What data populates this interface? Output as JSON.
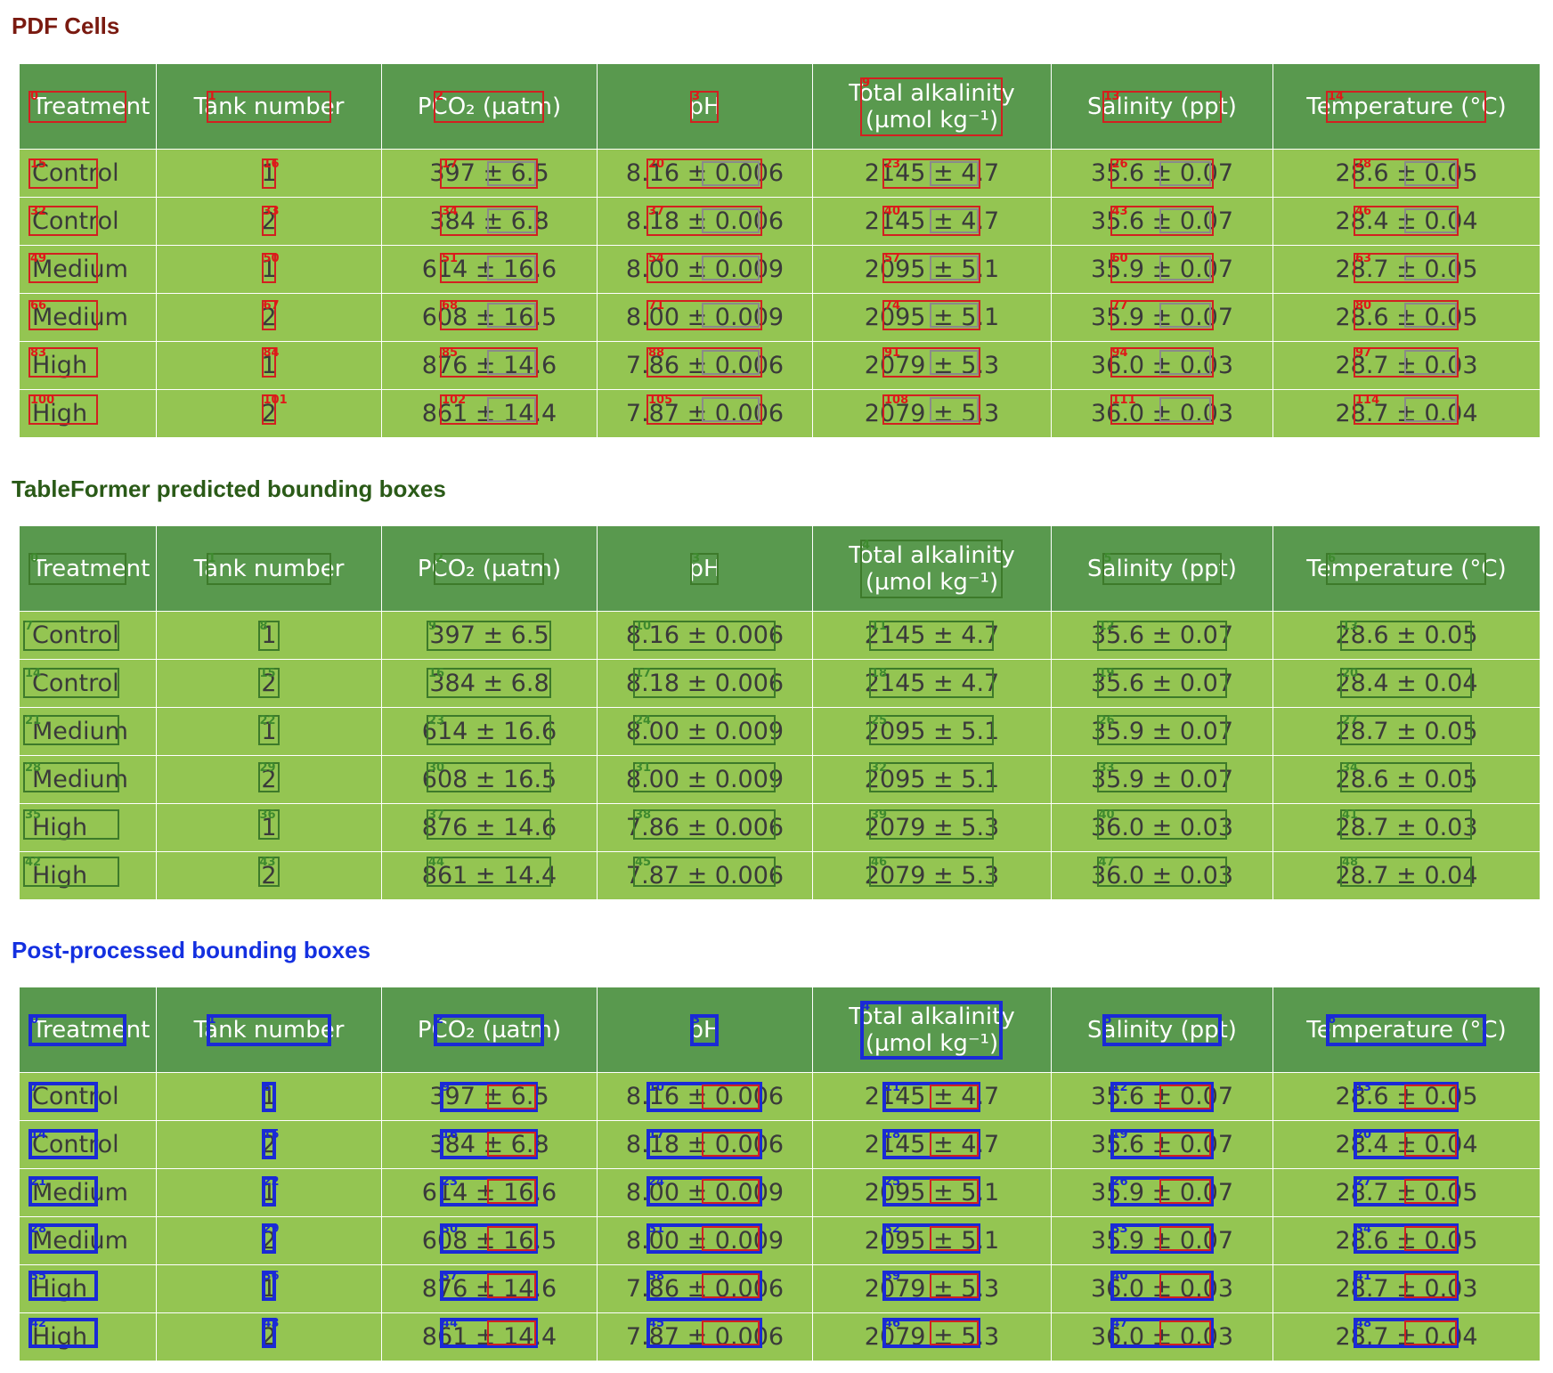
{
  "sections": [
    {
      "title": "PDF Cells",
      "color": "#7a1a10"
    },
    {
      "title": "TableFormer predicted bounding boxes",
      "color": "#2a5a17"
    },
    {
      "title": "Post-processed bounding boxes",
      "color": "#1430e0"
    }
  ],
  "table": {
    "header_bg": "#59994e",
    "body_bg": "#94c552",
    "headers": [
      {
        "line1": "Treatment",
        "line2": ""
      },
      {
        "line1": "Tank number",
        "line2": ""
      },
      {
        "line1": "PCO₂ (µatm)",
        "line2": ""
      },
      {
        "line1": "pH",
        "line2": ""
      },
      {
        "line1": "Total alkalinity",
        "line2": "(µmol kg⁻¹)"
      },
      {
        "line1": "Salinity (ppt)",
        "line2": ""
      },
      {
        "line1": "Temperature (°C)",
        "line2": ""
      }
    ],
    "rows": [
      [
        "Control",
        "1",
        "397 ± 6.5",
        "8.16 ± 0.006",
        "2145 ± 4.7",
        "35.6 ± 0.07",
        "28.6 ± 0.05"
      ],
      [
        "Control",
        "2",
        "384 ± 6.8",
        "8.18 ± 0.006",
        "2145 ± 4.7",
        "35.6 ± 0.07",
        "28.4 ± 0.04"
      ],
      [
        "Medium",
        "1",
        "614 ± 16.6",
        "8.00 ± 0.009",
        "2095 ± 5.1",
        "35.9 ± 0.07",
        "28.7 ± 0.05"
      ],
      [
        "Medium",
        "2",
        "608 ± 16.5",
        "8.00 ± 0.009",
        "2095 ± 5.1",
        "35.9 ± 0.07",
        "28.6 ± 0.05"
      ],
      [
        "High",
        "1",
        "876 ± 14.6",
        "7.86 ± 0.006",
        "2079 ± 5.3",
        "36.0 ± 0.03",
        "28.7 ± 0.03"
      ],
      [
        "High",
        "2",
        "861 ± 14.4",
        "7.87 ± 0.006",
        "2079 ± 5.3",
        "36.0 ± 0.03",
        "28.7 ± 0.04"
      ]
    ]
  },
  "overlay_colors": {
    "pdf_cell": "#d22020",
    "pdf_cell_secondary": "#8a8a8a",
    "predicted": "#3d7a2a",
    "postprocessed": "#1a2ad6"
  },
  "tableformer_indices": {
    "headers": [
      "0",
      "1",
      "2",
      "3",
      "4",
      "5",
      "6"
    ],
    "rows": [
      [
        "7",
        "8",
        "9",
        "10",
        "11",
        "12",
        "13"
      ],
      [
        "14",
        "15",
        "16",
        "17",
        "18",
        "19",
        "20"
      ],
      [
        "21",
        "22",
        "23",
        "24",
        "25",
        "26",
        "27"
      ],
      [
        "28",
        "29",
        "30",
        "31",
        "32",
        "33",
        "34"
      ],
      [
        "35",
        "36",
        "37",
        "38",
        "39",
        "40",
        "41"
      ],
      [
        "42",
        "43",
        "44",
        "45",
        "46",
        "47",
        "48"
      ]
    ]
  },
  "pdf_cell_indices": {
    "headers": [
      "0",
      "1",
      "2",
      "3",
      "9",
      "13",
      "14"
    ],
    "rows": [
      [
        "15",
        "16",
        "17",
        "20",
        "23",
        "26",
        "28"
      ],
      [
        "32",
        "33",
        "34",
        "37",
        "40",
        "43",
        "46"
      ],
      [
        "49",
        "50",
        "51",
        "54",
        "57",
        "60",
        "63"
      ],
      [
        "66",
        "67",
        "68",
        "71",
        "74",
        "77",
        "80"
      ],
      [
        "83",
        "84",
        "85",
        "88",
        "91",
        "94",
        "97"
      ],
      [
        "100",
        "101",
        "102",
        "105",
        "108",
        "111",
        "114"
      ]
    ]
  },
  "postprocessed_indices": {
    "headers": [
      "0",
      "1",
      "2",
      "3",
      "4",
      "5",
      "6"
    ],
    "rows": [
      [
        "7",
        "8",
        "9",
        "10",
        "11",
        "12",
        "13"
      ],
      [
        "14",
        "15",
        "16",
        "17",
        "18",
        "19",
        "20"
      ],
      [
        "21",
        "22",
        "23",
        "24",
        "25",
        "26",
        "27"
      ],
      [
        "28",
        "29",
        "30",
        "31",
        "32",
        "33",
        "34"
      ],
      [
        "35",
        "36",
        "37",
        "38",
        "39",
        "40",
        "41"
      ],
      [
        "42",
        "43",
        "44",
        "45",
        "46",
        "47",
        "48"
      ]
    ]
  }
}
